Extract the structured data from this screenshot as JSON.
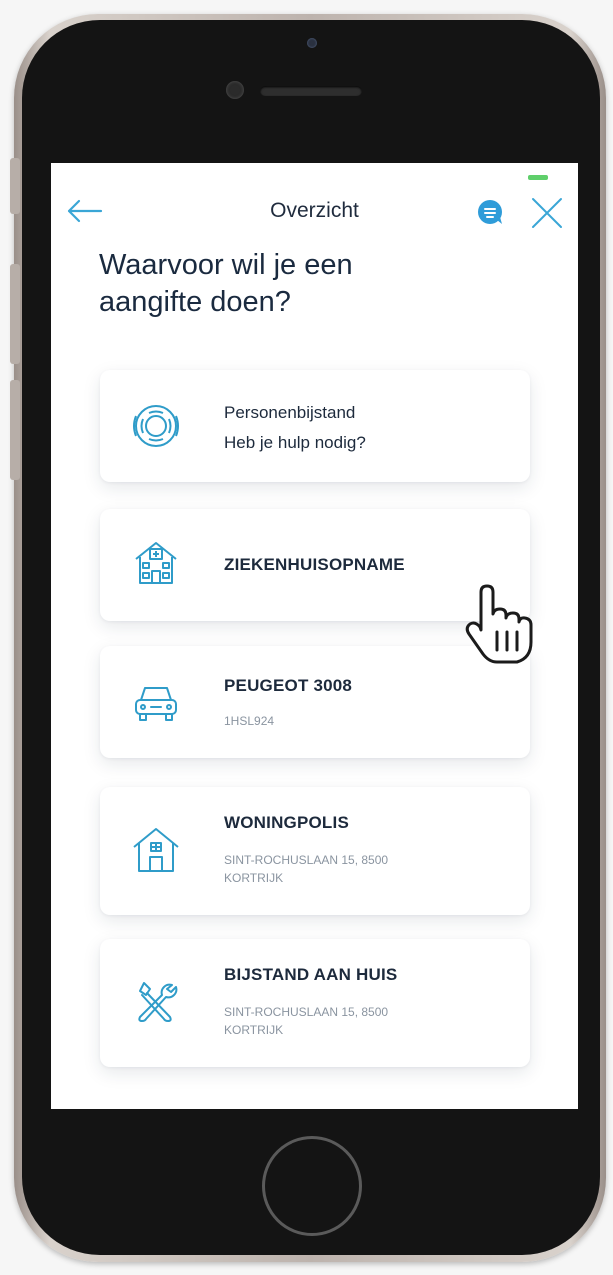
{
  "header": {
    "title": "Overzicht"
  },
  "page": {
    "title_line1": "Waarvoor wil je een",
    "title_line2": "aangifte doen?"
  },
  "cards": [
    {
      "icon": "lifebuoy-icon",
      "line1": "Personenbijstand",
      "line2": "Heb je hulp nodig?"
    },
    {
      "icon": "hospital-icon",
      "title": "ZIEKENHUISOPNAME"
    },
    {
      "icon": "car-icon",
      "title": "PEUGEOT 3008",
      "sub": "1HSL924"
    },
    {
      "icon": "house-icon",
      "title": "WONINGPOLIS",
      "sub_line1": "SINT-ROCHUSLAAN 15, 8500",
      "sub_line2": "KORTRIJK"
    },
    {
      "icon": "tools-icon",
      "title": "BIJSTAND AAN HUIS",
      "sub_line1": "SINT-ROCHUSLAAN 15, 8500",
      "sub_line2": "KORTRIJK"
    }
  ],
  "colors": {
    "accent": "#3aa6d6",
    "icon_stroke": "#2f9cc9",
    "title_text": "#1a2a3f",
    "muted_text": "#8a94a0",
    "battery": "#5fcf6b"
  }
}
